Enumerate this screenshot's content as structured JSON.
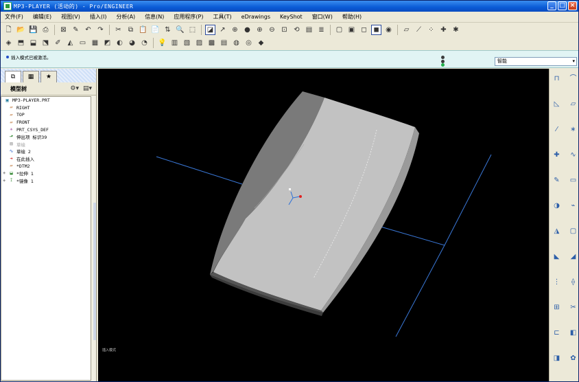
{
  "window": {
    "title": "MP3-PLAYER (活动的) - Pro/ENGINEER",
    "minimize": "_",
    "maximize": "□",
    "close": "×"
  },
  "menu": [
    "文件(F)",
    "编辑(E)",
    "视图(V)",
    "插入(I)",
    "分析(A)",
    "信息(N)",
    "应用程序(P)",
    "工具(T)",
    "eDrawings",
    "KeyShot",
    "窗口(W)",
    "帮助(H)"
  ],
  "toolbar_row1": [
    {
      "name": "new-file-icon",
      "glyph": "🗋"
    },
    {
      "name": "open-file-icon",
      "glyph": "📂"
    },
    {
      "name": "save-icon",
      "glyph": "💾"
    },
    {
      "name": "print-icon",
      "glyph": "⎙"
    },
    {
      "name": "sep"
    },
    {
      "name": "close-window-icon",
      "glyph": "⊠"
    },
    {
      "name": "regenerate-icon",
      "glyph": "✎"
    },
    {
      "name": "undo-icon",
      "glyph": "↶"
    },
    {
      "name": "redo-icon",
      "glyph": "↷"
    },
    {
      "name": "sep"
    },
    {
      "name": "cut-icon",
      "glyph": "✂"
    },
    {
      "name": "copy-icon",
      "glyph": "⧉"
    },
    {
      "name": "paste-icon",
      "glyph": "📋"
    },
    {
      "name": "paste-special-icon",
      "glyph": "📄"
    },
    {
      "name": "regenerate-model-icon",
      "glyph": "⇅"
    },
    {
      "name": "find-icon",
      "glyph": "🔍"
    },
    {
      "name": "select-box-icon",
      "glyph": "⬚"
    },
    {
      "name": "sep"
    },
    {
      "name": "repaint-icon",
      "glyph": "◪",
      "active": true
    },
    {
      "name": "orient-mode-icon",
      "glyph": "↗"
    },
    {
      "name": "spin-center-icon",
      "glyph": "⊕"
    },
    {
      "name": "shading-icon",
      "glyph": "●"
    },
    {
      "name": "zoom-in-icon",
      "glyph": "⊕"
    },
    {
      "name": "zoom-out-icon",
      "glyph": "⊖"
    },
    {
      "name": "refit-icon",
      "glyph": "⊡"
    },
    {
      "name": "reorient-icon",
      "glyph": "⟲"
    },
    {
      "name": "saved-views-icon",
      "glyph": "▤"
    },
    {
      "name": "layers-icon",
      "glyph": "≣"
    },
    {
      "name": "sep"
    },
    {
      "name": "wireframe-icon",
      "glyph": "▢"
    },
    {
      "name": "hidden-line-icon",
      "glyph": "▣"
    },
    {
      "name": "no-hidden-icon",
      "glyph": "◻"
    },
    {
      "name": "shaded-icon",
      "glyph": "◼",
      "active": true
    },
    {
      "name": "appearance-icon",
      "glyph": "◉"
    },
    {
      "name": "sep"
    },
    {
      "name": "datum-planes-icon",
      "glyph": "▱"
    },
    {
      "name": "datum-axes-icon",
      "glyph": "⟋"
    },
    {
      "name": "datum-points-icon",
      "glyph": "⁘"
    },
    {
      "name": "coord-sys-icon",
      "glyph": "✚"
    },
    {
      "name": "annotations-icon",
      "glyph": "✱"
    }
  ],
  "toolbar_row2": [
    {
      "name": "part-icon",
      "glyph": "◈"
    },
    {
      "name": "assembly-icon",
      "glyph": "⬒"
    },
    {
      "name": "drawing-icon",
      "glyph": "⬓"
    },
    {
      "name": "mold-icon",
      "glyph": "⬔"
    },
    {
      "name": "sketch-icon",
      "glyph": "✐"
    },
    {
      "name": "surface-icon",
      "glyph": "◭"
    },
    {
      "name": "sheetmetal-icon",
      "glyph": "▭"
    },
    {
      "name": "pattern-icon",
      "glyph": "▦"
    },
    {
      "name": "measure-icon",
      "glyph": "◩"
    },
    {
      "name": "analysis-icon",
      "glyph": "◐"
    },
    {
      "name": "model-check-icon",
      "glyph": "◕"
    },
    {
      "name": "render-icon",
      "glyph": "◔"
    },
    {
      "name": "sep"
    },
    {
      "name": "bulb-icon",
      "glyph": "💡"
    },
    {
      "name": "sheet-icon",
      "glyph": "▥"
    },
    {
      "name": "mapkey-icon",
      "glyph": "▧"
    },
    {
      "name": "relations-icon",
      "glyph": "▨"
    },
    {
      "name": "param-icon",
      "glyph": "▩"
    },
    {
      "name": "family-table-icon",
      "glyph": "▤"
    },
    {
      "name": "publish-icon",
      "glyph": "◍"
    },
    {
      "name": "keyshot-icon",
      "glyph": "◎"
    },
    {
      "name": "edrawings-icon",
      "glyph": "◆"
    }
  ],
  "status": {
    "message": "插入模式已被激活。",
    "filter_value": "智能",
    "traffic_colors": [
      "#3b3b3b",
      "#3b3b3b",
      "#22b14c"
    ]
  },
  "panel": {
    "tabs": [
      {
        "name": "model-tree-tab",
        "glyph": "⧉"
      },
      {
        "name": "folder-browser-tab",
        "glyph": "▦"
      },
      {
        "name": "favorites-tab",
        "glyph": "★"
      }
    ],
    "title": "模型树",
    "settings_glyph": "⚙▾",
    "show_glyph": "▤▾",
    "tree": [
      {
        "label": "MP3-PLAYER.PRT",
        "icon": "part-icon",
        "glyph": "▣",
        "depth": 0,
        "dim": false,
        "color": "#1f7a9b"
      },
      {
        "label": "RIGHT",
        "icon": "datum-plane-icon",
        "glyph": "▱",
        "depth": 1,
        "dim": false,
        "color": "#b05a10"
      },
      {
        "label": "TOP",
        "icon": "datum-plane-icon",
        "glyph": "▱",
        "depth": 1,
        "dim": false,
        "color": "#b05a10"
      },
      {
        "label": "FRONT",
        "icon": "datum-plane-icon",
        "glyph": "▱",
        "depth": 1,
        "dim": false,
        "color": "#b05a10"
      },
      {
        "label": "PRT_CSYS_DEF",
        "icon": "coord-sys-icon",
        "glyph": "✳",
        "depth": 1,
        "dim": false,
        "color": "#8a2a8a"
      },
      {
        "label": "伸出项 标识39",
        "icon": "extrude-icon",
        "glyph": "⬏",
        "depth": 1,
        "dim": false,
        "color": "#1a7a1a"
      },
      {
        "label": "草绘",
        "icon": "sketch-icon",
        "glyph": "▨",
        "depth": 1,
        "dim": true,
        "color": "#9a9a9a"
      },
      {
        "label": "草绘 2",
        "icon": "sketch-icon",
        "glyph": "∿",
        "depth": 1,
        "dim": false,
        "color": "#2a5fc7"
      },
      {
        "label": "在此插入",
        "icon": "insert-here-icon",
        "glyph": "➜",
        "depth": 1,
        "dim": false,
        "color": "#d11a1a"
      },
      {
        "label": "*DTM2",
        "icon": "datum-plane-icon",
        "glyph": "▱",
        "depth": 1,
        "dim": false,
        "color": "#b05a10"
      },
      {
        "label": "*拉伸 1",
        "icon": "extrude-icon",
        "glyph": "⬓",
        "depth": 1,
        "dim": false,
        "color": "#1a7a1a",
        "expand": "+"
      },
      {
        "label": "*镜像 1",
        "icon": "mirror-icon",
        "glyph": "⟟",
        "depth": 1,
        "dim": false,
        "color": "#1a7a1a",
        "expand": "+"
      }
    ]
  },
  "viewport": {
    "label": "插入模式"
  },
  "right_toolbar": [
    {
      "name": "hole-icon",
      "glyph": "⊓"
    },
    {
      "name": "round-icon",
      "glyph": "⌒"
    },
    {
      "name": "chamfer-icon",
      "glyph": "◺"
    },
    {
      "name": "datum-plane-tool-icon",
      "glyph": "▱"
    },
    {
      "name": "datum-axis-tool-icon",
      "glyph": "⁄"
    },
    {
      "name": "datum-point-tool-icon",
      "glyph": "∗"
    },
    {
      "name": "datum-csys-tool-icon",
      "glyph": "✚"
    },
    {
      "name": "curve-icon",
      "glyph": "∿"
    },
    {
      "name": "sketch-tool-icon",
      "glyph": "✎"
    },
    {
      "name": "extrude-tool-icon",
      "glyph": "▭"
    },
    {
      "name": "revolve-tool-icon",
      "glyph": "◑"
    },
    {
      "name": "sweep-icon",
      "glyph": "⌁"
    },
    {
      "name": "blend-icon",
      "glyph": "◮"
    },
    {
      "name": "shell-icon",
      "glyph": "▢"
    },
    {
      "name": "rib-icon",
      "glyph": "◣"
    },
    {
      "name": "draft-icon",
      "glyph": "◢"
    },
    {
      "name": "pattern-tool-icon",
      "glyph": "⋮"
    },
    {
      "name": "mirror-tool-icon",
      "glyph": "⟠"
    },
    {
      "name": "merge-icon",
      "glyph": "⊞"
    },
    {
      "name": "trim-icon",
      "glyph": "✂"
    },
    {
      "name": "offset-icon",
      "glyph": "⊏"
    },
    {
      "name": "thicken-icon",
      "glyph": "◧"
    },
    {
      "name": "solidify-icon",
      "glyph": "◨"
    },
    {
      "name": "style-icon",
      "glyph": "✿"
    }
  ]
}
